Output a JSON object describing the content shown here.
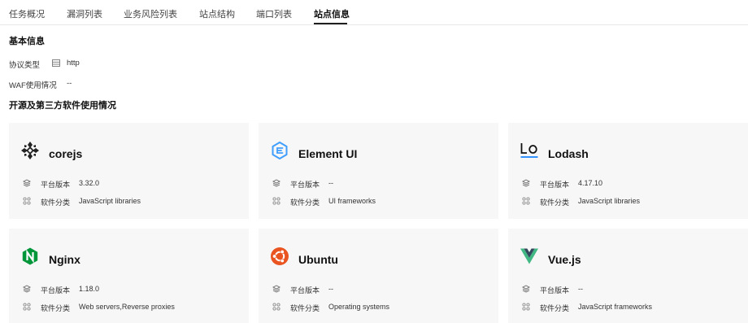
{
  "tabs": [
    {
      "label": "任务概况",
      "active": false
    },
    {
      "label": "漏洞列表",
      "active": false
    },
    {
      "label": "业务风险列表",
      "active": false
    },
    {
      "label": "站点结构",
      "active": false
    },
    {
      "label": "端口列表",
      "active": false
    },
    {
      "label": "站点信息",
      "active": true
    }
  ],
  "basic_info": {
    "title": "基本信息",
    "protocol_label": "协议类型",
    "protocol_icon": "server-icon",
    "protocol_value": "http",
    "waf_label": "WAF使用情况",
    "waf_value": "--"
  },
  "software": {
    "title": "开源及第三方软件使用情况",
    "version_label": "平台版本",
    "category_label": "软件分类",
    "items": [
      {
        "name": "corejs",
        "version": "3.32.0",
        "category": "JavaScript libraries",
        "icon": "corejs-logo-icon"
      },
      {
        "name": "Element UI",
        "version": "--",
        "category": "UI frameworks",
        "icon": "element-ui-logo-icon",
        "color": "#409eff"
      },
      {
        "name": "Lodash",
        "version": "4.17.10",
        "category": "JavaScript libraries",
        "icon": "lodash-logo-icon",
        "color": "#3492ff"
      },
      {
        "name": "Nginx",
        "version": "1.18.0",
        "category": "Web servers,Reverse proxies",
        "icon": "nginx-logo-icon",
        "color": "#009639"
      },
      {
        "name": "Ubuntu",
        "version": "--",
        "category": "Operating systems",
        "icon": "ubuntu-logo-icon",
        "color": "#e95420"
      },
      {
        "name": "Vue.js",
        "version": "--",
        "category": "JavaScript frameworks",
        "icon": "vuejs-logo-icon",
        "color": "#41b883"
      }
    ]
  }
}
